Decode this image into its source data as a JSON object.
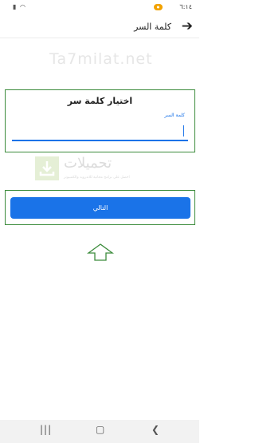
{
  "status_bar": {
    "time": "٦:١٤",
    "left_icons": "▮ ◠"
  },
  "app_bar": {
    "back_icon": "arrow-right-icon",
    "title": "كلمة السر"
  },
  "watermark": {
    "site_text": "Ta7milat.net",
    "logo_text": "تحميلات",
    "logo_sub": "احصل على برامج مجانية للاندرويد والكمبيوتر"
  },
  "form": {
    "title": "اختيار كلمة سر",
    "field_label": "كلمة السر",
    "input_value": ""
  },
  "next_button": {
    "label": "التالي"
  },
  "nav_bar": {
    "recents": "|||",
    "home": "▢",
    "back": "❮"
  },
  "colors": {
    "accent": "#1a73e8",
    "highlight_frame": "#3c8c3c"
  }
}
